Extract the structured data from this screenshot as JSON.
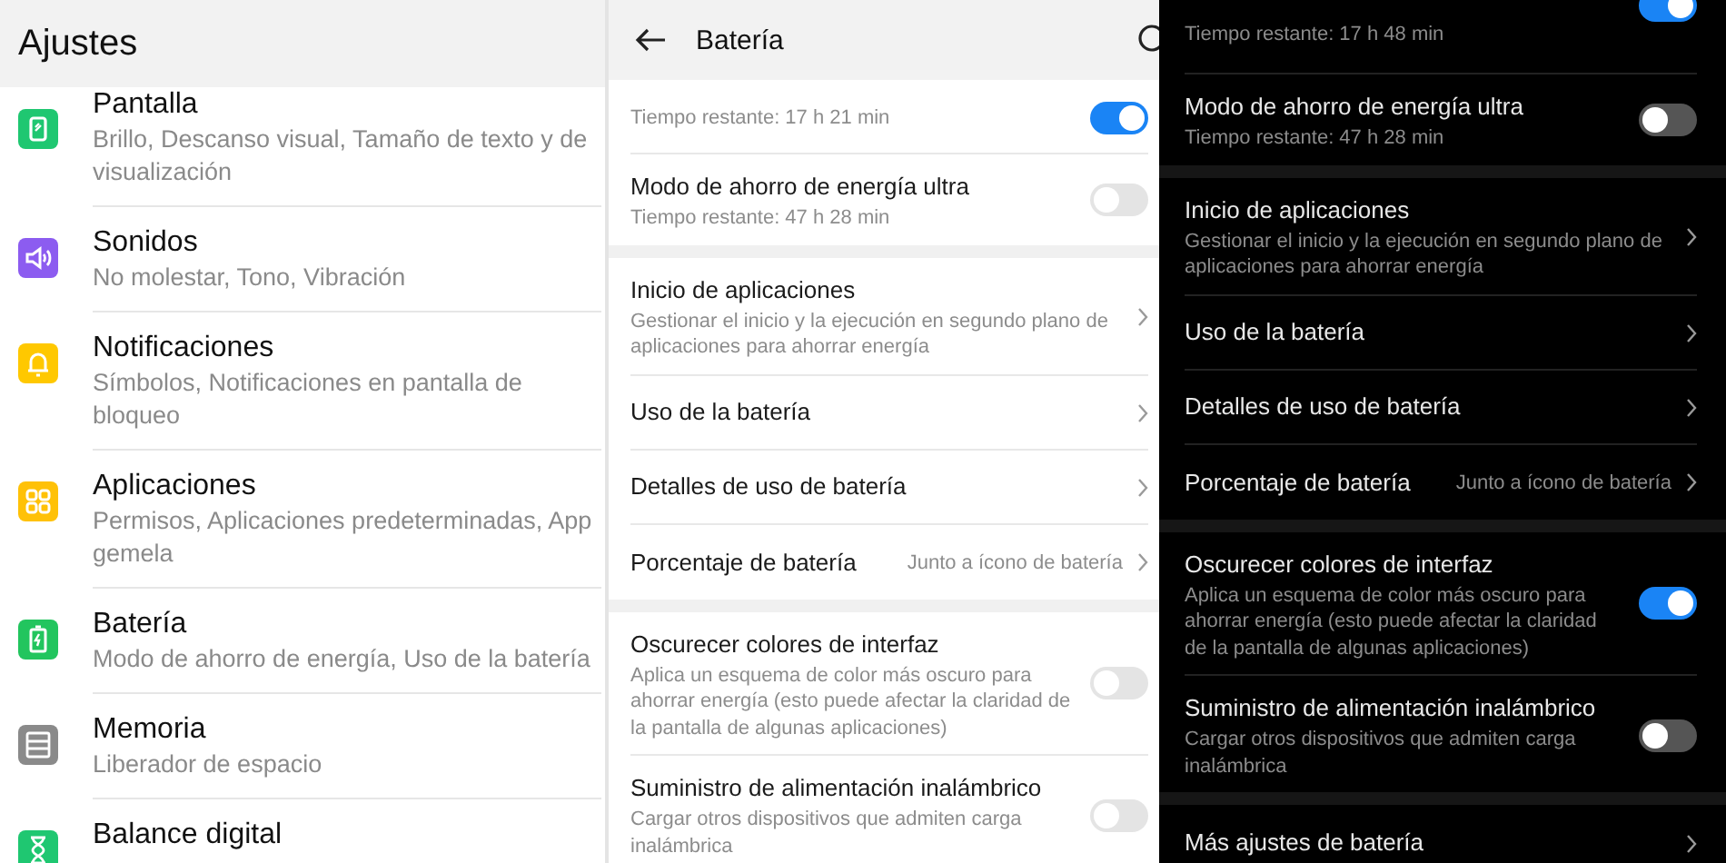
{
  "settings": {
    "title": "Ajustes",
    "items": [
      {
        "title": "Pantalla",
        "subtitle": "Brillo, Descanso visual, Tamaño de texto y de visualización",
        "color": "#1fc771"
      },
      {
        "title": "Sonidos",
        "subtitle": "No molestar, Tono, Vibración",
        "color": "#8c5cf0"
      },
      {
        "title": "Notificaciones",
        "subtitle": "Símbolos, Notificaciones en pantalla de bloqueo",
        "color": "#ffc800"
      },
      {
        "title": "Aplicaciones",
        "subtitle": "Permisos, Aplicaciones predeterminadas, App gemela",
        "color": "#ffc107"
      },
      {
        "title": "Batería",
        "subtitle": "Modo de ahorro de energía, Uso de la batería",
        "color": "#22c55e"
      },
      {
        "title": "Memoria",
        "subtitle": "Liberador de espacio",
        "color": "#8a8a8a"
      },
      {
        "title": "Balance digital",
        "color": "#1fc771"
      }
    ]
  },
  "battery_light": {
    "title": "Batería",
    "sections": [
      [
        {
          "kind": "toggle",
          "subtitle": "Tiempo restante: 17 h 21 min",
          "on": true
        },
        {
          "kind": "toggle",
          "title": "Modo de ahorro de energía ultra",
          "subtitle": "Tiempo restante: 47 h 28 min",
          "on": false
        }
      ],
      [
        {
          "kind": "link",
          "title": "Inicio de aplicaciones",
          "subtitle": "Gestionar el inicio y la ejecución en segundo plano de aplicaciones para ahorrar energía"
        },
        {
          "kind": "link",
          "title": "Uso de la batería"
        },
        {
          "kind": "link",
          "title": "Detalles de uso de batería"
        },
        {
          "kind": "link",
          "title": "Porcentaje de batería",
          "value": "Junto a ícono de batería"
        }
      ],
      [
        {
          "kind": "toggle",
          "title": "Oscurecer colores de interfaz",
          "subtitle": "Aplica un esquema de color más oscuro para ahorrar energía (esto puede afectar la claridad de la pantalla de algunas aplicaciones)",
          "on": false
        },
        {
          "kind": "toggle",
          "title": "Suministro de alimentación inalámbrico",
          "subtitle": "Cargar otros dispositivos que admiten carga inalámbrica",
          "on": false
        }
      ]
    ]
  },
  "battery_dark": {
    "sections": [
      [
        {
          "kind": "toggle",
          "subtitle": "Tiempo restante: 17 h 48 min",
          "on": true
        },
        {
          "kind": "toggle",
          "title": "Modo de ahorro de energía ultra",
          "subtitle": "Tiempo restante: 47 h 28 min",
          "on": false
        }
      ],
      [
        {
          "kind": "link",
          "title": "Inicio de aplicaciones",
          "subtitle": "Gestionar el inicio y la ejecución en segundo plano de aplicaciones para ahorrar energía"
        },
        {
          "kind": "link",
          "title": "Uso de la batería"
        },
        {
          "kind": "link",
          "title": "Detalles de uso de batería"
        },
        {
          "kind": "link",
          "title": "Porcentaje de batería",
          "value": "Junto a ícono de batería"
        }
      ],
      [
        {
          "kind": "toggle",
          "title": "Oscurecer colores de interfaz",
          "subtitle": "Aplica un esquema de color más oscuro para ahorrar energía (esto puede afectar la claridad de la pantalla de algunas aplicaciones)",
          "on": true
        },
        {
          "kind": "toggle",
          "title": "Suministro de alimentación inalámbrico",
          "subtitle": "Cargar otros dispositivos que admiten carga inalámbrica",
          "on": false
        }
      ],
      [
        {
          "kind": "link",
          "title": "Más ajustes de batería"
        }
      ]
    ]
  }
}
